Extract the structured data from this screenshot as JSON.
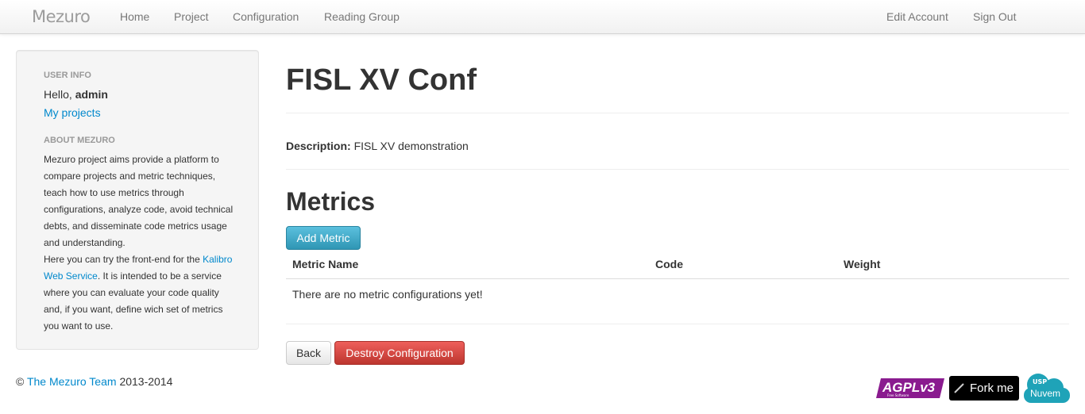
{
  "navbar": {
    "brand": "Mezuro",
    "links": [
      "Home",
      "Project",
      "Configuration",
      "Reading Group"
    ],
    "right_links": [
      "Edit Account",
      "Sign Out"
    ]
  },
  "sidebar": {
    "user_info_header": "USER INFO",
    "hello_prefix": "Hello,",
    "username": "admin",
    "my_projects": "My projects",
    "about_header": "ABOUT MEZURO",
    "about_text_1": "Mezuro project aims provide a platform to compare projects and metric techniques, teach how to use metrics through configurations, analyze code, avoid technical debts, and disseminate code metrics usage and understanding.",
    "about_text_2_prefix": "Here you can try the front-end for the",
    "about_link": "Kalibro Web Service",
    "about_text_2_suffix": ". It is intended to be a service where you can evaluate your code quality and, if you want, define wich set of metrics you want to use."
  },
  "main": {
    "title": "FISL XV Conf",
    "description_label": "Description:",
    "description_value": "FISL XV demonstration",
    "metrics_title": "Metrics",
    "add_metric_button": "Add Metric",
    "table": {
      "headers": [
        "Metric Name",
        "Code",
        "Weight"
      ],
      "empty_message": "There are no metric configurations yet!"
    },
    "back_button": "Back",
    "destroy_button": "Destroy Configuration"
  },
  "footer": {
    "copyright_symbol": "©",
    "team_link": "The Mezuro Team",
    "years": "2013-2014",
    "badges": {
      "agpl": "AGPLv3",
      "agpl_sub": "Free Software",
      "fork": "Fork me",
      "nuvem": "Nuvem",
      "nuvem_mark": "USP"
    }
  },
  "colors": {
    "link": "#0088cc",
    "info_button": "#49afcd",
    "danger_button": "#da4f49",
    "agpl_purple": "#8a1b8f",
    "nuvem_teal": "#1fa3b8"
  }
}
